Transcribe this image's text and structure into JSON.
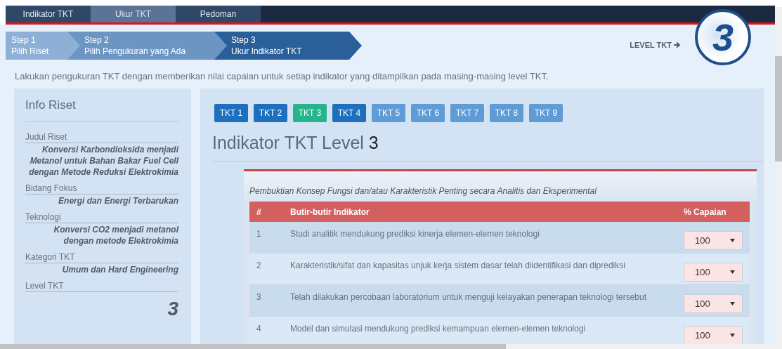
{
  "nav": {
    "tabs": [
      {
        "label": "Indikator TKT",
        "selected": false
      },
      {
        "label": "Ukur TKT",
        "selected": true
      },
      {
        "label": "Pedoman",
        "selected": false
      }
    ]
  },
  "steps": [
    {
      "step": "Step 1",
      "label": "Pilih Riset",
      "selected": false
    },
    {
      "step": "Step 2",
      "label": "Pilih Pengukuran yang Ada",
      "selected": false
    },
    {
      "step": "Step 3",
      "label": "Ukur Indikator TKT",
      "selected": true
    }
  ],
  "level_badge": {
    "label": "LEVEL TKT",
    "value": "3"
  },
  "instruction": "Lakukan pengukuran TKT dengan memberikan nilai capaian untuk setiap indikator yang ditampilkan pada masing-masing level TKT.",
  "info": {
    "title": "Info Riset",
    "fields": [
      {
        "label": "Judul Riset",
        "value": "Konversi Karbondioksida menjadi Metanol untuk Bahan Bakar Fuel Cell dengan Metode Reduksi Elektrokimia",
        "kind": "text"
      },
      {
        "label": "Bidang Fokus",
        "value": "Energi dan Energi Terbarukan",
        "kind": "text"
      },
      {
        "label": "Teknologi",
        "value": "Konversi CO2 menjadi metanol dengan metode Elektrokimia",
        "kind": "text"
      },
      {
        "label": "Kategori TKT",
        "value": "Umum dan Hard Engineering",
        "kind": "text"
      },
      {
        "label": "Level TKT",
        "value": "3",
        "kind": "big"
      }
    ]
  },
  "level_tabs": [
    {
      "label": "TKT 1",
      "selected": false,
      "done": true
    },
    {
      "label": "TKT 2",
      "selected": false,
      "done": true
    },
    {
      "label": "TKT 3",
      "selected": true,
      "done": true
    },
    {
      "label": "TKT 4",
      "selected": false,
      "done": true
    },
    {
      "label": "TKT 5",
      "selected": false,
      "done": false
    },
    {
      "label": "TKT 6",
      "selected": false,
      "done": false
    },
    {
      "label": "TKT 7",
      "selected": false,
      "done": false
    },
    {
      "label": "TKT 8",
      "selected": false,
      "done": false
    },
    {
      "label": "TKT 9",
      "selected": false,
      "done": false
    }
  ],
  "heading": {
    "text": "Indikator TKT Level",
    "level": "3"
  },
  "table": {
    "caption": "Pembuktian Konsep Fungsi dan/atau Karakteristik Penting secara Analitis dan Eksperimental",
    "columns": [
      "#",
      "Butir-butir Indikator",
      "% Capaian"
    ],
    "rows": [
      {
        "number": "1",
        "indicator": "Studi analitik mendukung prediksi kinerja elemen-elemen teknologi",
        "capaian": "100"
      },
      {
        "number": "2",
        "indicator": "Karakteristik/sifat dan kapasitas unjuk kerja sistem dasar telah diidentifikasi dan diprediksi",
        "capaian": "100"
      },
      {
        "number": "3",
        "indicator": "Telah dilakukan percobaan laboratorium untuk menguji kelayakan penerapan teknologi tersebut",
        "capaian": "100"
      },
      {
        "number": "4",
        "indicator": "Model dan simulasi mendukung prediksi kemampuan elemen-elemen teknologi",
        "capaian": "100"
      }
    ]
  }
}
